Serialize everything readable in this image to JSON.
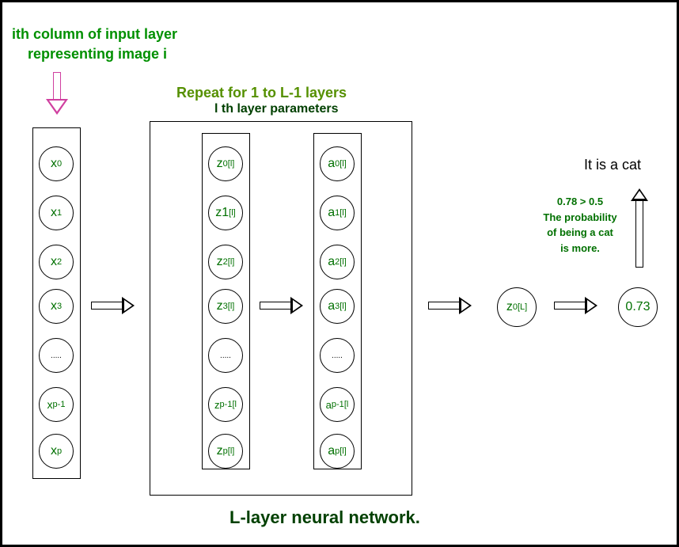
{
  "top_label": {
    "line1": "ith column of input layer",
    "line2": "representing image i"
  },
  "repeat_label": "Repeat for 1 to L-1 layers",
  "layer_params_label": "l th layer parameters",
  "bottom_title": "L-layer neural network.",
  "cat_label": "It is a cat",
  "prob_text": {
    "l1": "0.78 > 0.5",
    "l2": "The probability",
    "l3": "of being a cat",
    "l4": "is more."
  },
  "input_nodes": [
    "x₀",
    "x₁",
    "x₂",
    "x₃",
    ".....",
    "xₚ₋₁",
    "xₚ"
  ],
  "z_nodes": [
    "z0_l",
    "z1_l",
    "z2_l",
    "z3_l",
    ".....",
    "zp-1_l",
    "zp_l"
  ],
  "a_nodes": [
    "a0_l",
    "a1_l",
    "a2_l",
    "a3_l",
    ".....",
    "ap-1_l",
    "ap_l"
  ],
  "z_final": "z0_L",
  "output_value": "0.73"
}
